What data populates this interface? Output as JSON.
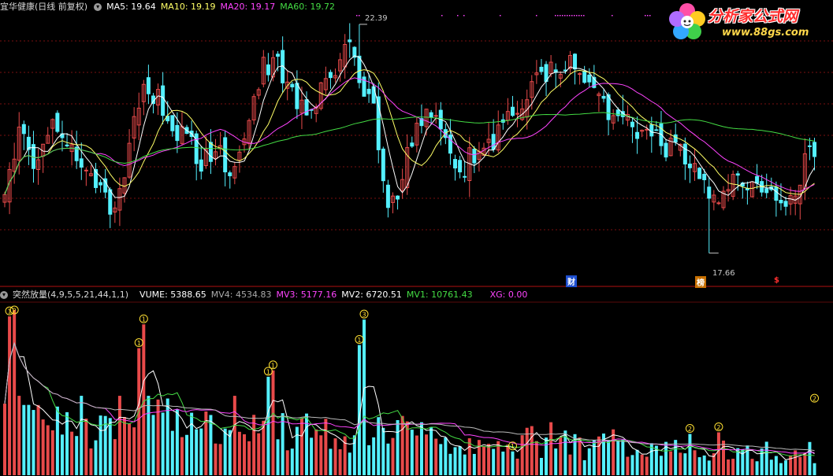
{
  "main_header": {
    "stock_name": "宜华健康(日线 前复权)",
    "ma5": "MA5: 19.64",
    "ma10": "MA10: 19.19",
    "ma20": "MA20: 19.17",
    "ma60": "MA60: 19.72"
  },
  "volume_header": {
    "indicator": "突然放量(4,9,5,5,21,44,1,1)",
    "vume": "VUME: 5388.65",
    "mv4": "MV4: 4534.83",
    "mv3": "MV3: 5177.16",
    "mv2": "MV2: 6720.51",
    "mv1": "MV1: 10761.43",
    "xg": "XG: 0.00"
  },
  "price_annotations": {
    "high": "22.39",
    "low": "17.66"
  },
  "event_markers": {
    "cai": "财",
    "bang": "榜",
    "dollar": "$"
  },
  "logo": {
    "text": "分析家公式网",
    "url_text": "www.88gs.com"
  },
  "colors": {
    "up": "#e84a4a",
    "down": "#54f0ff",
    "ma5": "#ffffff",
    "ma10": "#ffff66",
    "ma20": "#ff44ff",
    "ma60": "#44dd44",
    "mv4": "#ffffff",
    "mv3": "#ff44ff",
    "mv2": "#ffffff",
    "mv1": "#44dd44",
    "marker": "#ffe033",
    "grid": "#7a1010"
  },
  "chart_data": [
    {
      "type": "candlestick",
      "title": "宜华健康(日线 前复权)",
      "series_names": [
        "MA5",
        "MA10",
        "MA20",
        "MA60"
      ],
      "ylim": [
        17.2,
        22.6
      ],
      "bars": 170,
      "control_points": [
        [
          0,
          19.0
        ],
        [
          3,
          20.1
        ],
        [
          6,
          19.5
        ],
        [
          10,
          20.3
        ],
        [
          14,
          19.8
        ],
        [
          18,
          19.2
        ],
        [
          22,
          18.6
        ],
        [
          25,
          19.2
        ],
        [
          28,
          20.9
        ],
        [
          31,
          21.0
        ],
        [
          34,
          20.4
        ],
        [
          38,
          20.0
        ],
        [
          41,
          19.6
        ],
        [
          45,
          19.7
        ],
        [
          48,
          19.3
        ],
        [
          51,
          20.3
        ],
        [
          54,
          21.5
        ],
        [
          57,
          21.6
        ],
        [
          60,
          21.0
        ],
        [
          63,
          20.6
        ],
        [
          66,
          21.0
        ],
        [
          69,
          21.3
        ],
        [
          72,
          22.0
        ],
        [
          74,
          21.2
        ],
        [
          77,
          20.8
        ],
        [
          79,
          19.0
        ],
        [
          81,
          18.7
        ],
        [
          84,
          19.6
        ],
        [
          87,
          20.4
        ],
        [
          90,
          20.5
        ],
        [
          92,
          19.8
        ],
        [
          95,
          19.3
        ],
        [
          97,
          19.6
        ],
        [
          100,
          19.7
        ],
        [
          103,
          20.1
        ],
        [
          106,
          20.5
        ],
        [
          109,
          21.0
        ],
        [
          112,
          21.3
        ],
        [
          115,
          21.4
        ],
        [
          118,
          21.5
        ],
        [
          121,
          21.1
        ],
        [
          124,
          20.8
        ],
        [
          127,
          20.4
        ],
        [
          130,
          20.3
        ],
        [
          133,
          20.2
        ],
        [
          136,
          20.0
        ],
        [
          139,
          19.8
        ],
        [
          142,
          19.7
        ],
        [
          145,
          19.4
        ],
        [
          147,
          18.8
        ],
        [
          150,
          19.0
        ],
        [
          153,
          19.3
        ],
        [
          156,
          19.1
        ],
        [
          159,
          19.1
        ],
        [
          162,
          18.8
        ],
        [
          165,
          18.6
        ],
        [
          167,
          19.5
        ],
        [
          169,
          19.9
        ]
      ],
      "ma_latest": {
        "MA5": 19.64,
        "MA10": 19.19,
        "MA20": 19.17,
        "MA60": 19.72
      },
      "high_marker": {
        "bar": 74,
        "value": 22.39
      },
      "low_marker": {
        "bar": 147,
        "value": 17.66
      }
    },
    {
      "type": "bar",
      "title": "突然放量(4,9,5,5,21,44,1,1)",
      "series_names": [
        "VUME",
        "MV4",
        "MV3",
        "MV2",
        "MV1",
        "XG"
      ],
      "latest": {
        "VUME": 5388.65,
        "MV4": 4534.83,
        "MV3": 5177.16,
        "MV2": 6720.51,
        "MV1": 10761.43,
        "XG": 0.0
      },
      "spikes": [
        {
          "bar": 1,
          "value": 1.0,
          "label": "①"
        },
        {
          "bar": 2,
          "value": 1.04,
          "label": "②"
        },
        {
          "bar": 28,
          "value": 0.8,
          "label": "①"
        },
        {
          "bar": 29,
          "value": 0.95,
          "label": "①"
        },
        {
          "bar": 55,
          "value": 0.62,
          "label": "①"
        },
        {
          "bar": 56,
          "value": 0.66,
          "label": "①"
        },
        {
          "bar": 74,
          "value": 0.82,
          "label": "①"
        },
        {
          "bar": 75,
          "value": 0.98,
          "label": "③"
        },
        {
          "bar": 106,
          "value": 0.15,
          "label": "①"
        },
        {
          "bar": 143,
          "value": 0.26,
          "label": "②"
        },
        {
          "bar": 149,
          "value": 0.27,
          "label": "②"
        },
        {
          "bar": 170,
          "value": 0.45,
          "label": "②"
        }
      ]
    }
  ]
}
